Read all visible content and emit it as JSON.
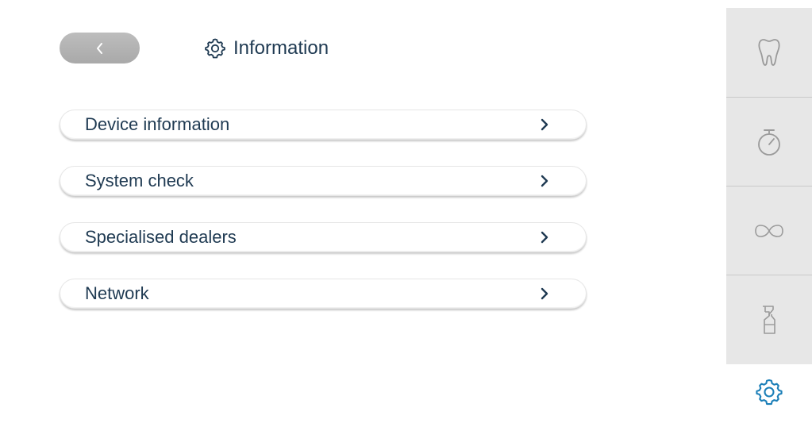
{
  "header": {
    "back_icon": "chevron-left-icon",
    "title_icon": "gear-icon",
    "title": "Information"
  },
  "menu": {
    "items": [
      {
        "label": "Device information",
        "icon": "chevron-right-icon"
      },
      {
        "label": "System check",
        "icon": "chevron-right-icon"
      },
      {
        "label": "Specialised dealers",
        "icon": "chevron-right-icon"
      },
      {
        "label": "Network",
        "icon": "chevron-right-icon"
      }
    ]
  },
  "side_nav": {
    "items": [
      {
        "icon": "tooth-icon"
      },
      {
        "icon": "stopwatch-icon"
      },
      {
        "icon": "infinity-icon"
      },
      {
        "icon": "spray-bottle-icon"
      }
    ],
    "active": {
      "icon": "gear-icon"
    }
  },
  "colors": {
    "text": "#1f3a52",
    "back_button": "#b3b3b3",
    "side_nav_bg": "#e7e7e7",
    "side_icon": "#9a9a9a",
    "active_icon": "#1c7fb8"
  }
}
